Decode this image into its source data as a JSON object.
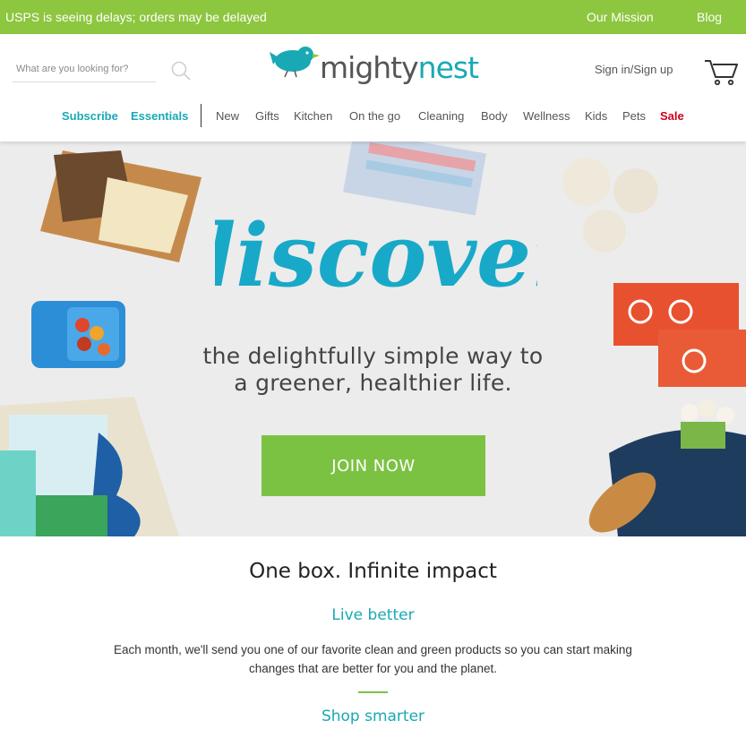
{
  "topbar": {
    "notice": "USPS is seeing delays; orders may be delayed",
    "mission": "Our Mission",
    "blog": "Blog"
  },
  "header": {
    "search_placeholder": "What are you looking for?",
    "logo": {
      "part1": "mighty",
      "part2": "nest"
    },
    "signin": "Sign in/Sign up"
  },
  "nav": {
    "subscribe": "Subscribe",
    "essentials": "Essentials",
    "items": [
      "New",
      "Gifts",
      "Kitchen",
      "On the go",
      "Cleaning",
      "Body",
      "Wellness",
      "Kids",
      "Pets"
    ],
    "sale": "Sale"
  },
  "hero": {
    "tagline_line1": "the delightfully simple way to",
    "tagline_line2": "a greener, healthier life.",
    "join": "JOIN NOW"
  },
  "content": {
    "headline": "One box. Infinite impact",
    "sub1": "Live better",
    "para": "Each month, we'll send you one of our favorite clean and green products so you can start making changes that are better for you and the planet.",
    "sub2": "Shop smarter"
  },
  "colors": {
    "green": "#8dc63f",
    "teal": "#19a9b5",
    "sale": "#d0021b",
    "button": "#7cc242"
  }
}
